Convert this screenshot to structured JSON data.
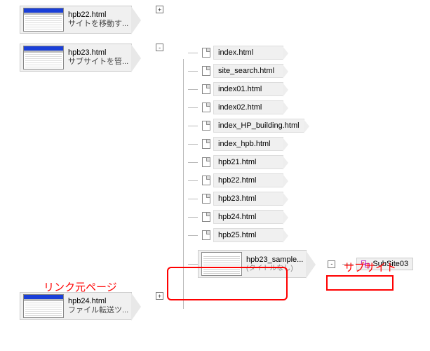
{
  "nodes": [
    {
      "file": "hpb22.html",
      "subtitle": "サイトを移動す...",
      "toggle": "+"
    },
    {
      "file": "hpb23.html",
      "subtitle": "サブサイトを管...",
      "toggle": "-"
    },
    {
      "file": "hpb24.html",
      "subtitle": "ファイル転送ツ...",
      "toggle": "+"
    }
  ],
  "children": [
    "index.html",
    "site_search.html",
    "index01.html",
    "index02.html",
    "index_HP_building.html",
    "index_hpb.html",
    "hpb21.html",
    "hpb22.html",
    "hpb23.html",
    "hpb24.html",
    "hpb25.html"
  ],
  "sample_node": {
    "file": "hpb23_sample...",
    "subtitle": "(タイトルなし)",
    "toggle": "-"
  },
  "subsite": {
    "label": "SubSite03"
  },
  "annotations": {
    "left": "リンク元ページ",
    "right": "サブサイト"
  }
}
